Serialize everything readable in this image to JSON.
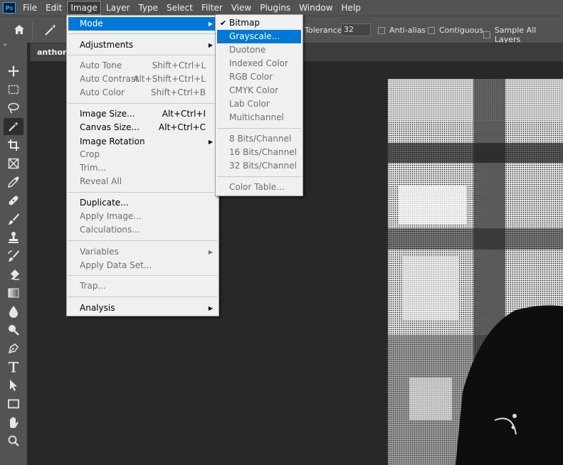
{
  "app": {
    "logo_text": "Ps"
  },
  "menubar": {
    "items": [
      "File",
      "Edit",
      "Image",
      "Layer",
      "Type",
      "Select",
      "Filter",
      "View",
      "Plugins",
      "Window",
      "Help"
    ]
  },
  "options": {
    "tolerance_label": "Tolerance:",
    "tolerance_value": "32",
    "antialias_label": "Anti-alias",
    "contiguous_label": "Contiguous",
    "sample_all_label": "Sample All Layers"
  },
  "toolbar": {
    "collapse": "»"
  },
  "tab": {
    "label": "anthony"
  },
  "image_menu": {
    "mode": "Mode",
    "adjustments": "Adjustments",
    "auto_tone": "Auto Tone",
    "auto_tone_sc": "Shift+Ctrl+L",
    "auto_contrast": "Auto Contrast",
    "auto_contrast_sc": "Alt+Shift+Ctrl+L",
    "auto_color": "Auto Color",
    "auto_color_sc": "Shift+Ctrl+B",
    "image_size": "Image Size...",
    "image_size_sc": "Alt+Ctrl+I",
    "canvas_size": "Canvas Size...",
    "canvas_size_sc": "Alt+Ctrl+C",
    "image_rotation": "Image Rotation",
    "crop": "Crop",
    "trim": "Trim...",
    "reveal_all": "Reveal All",
    "duplicate": "Duplicate...",
    "apply_image": "Apply Image...",
    "calculations": "Calculations...",
    "variables": "Variables",
    "apply_data_set": "Apply Data Set...",
    "trap": "Trap...",
    "analysis": "Analysis"
  },
  "mode_menu": {
    "bitmap": "Bitmap",
    "grayscale": "Grayscale...",
    "duotone": "Duotone",
    "indexed": "Indexed Color",
    "rgb": "RGB Color",
    "cmyk": "CMYK Color",
    "lab": "Lab Color",
    "multichannel": "Multichannel",
    "bits8": "8 Bits/Channel",
    "bits16": "16 Bits/Channel",
    "bits32": "32 Bits/Channel",
    "color_table": "Color Table..."
  },
  "colors": {
    "highlight": "#0078d7",
    "menubar": "#535353",
    "workspace": "#282828"
  }
}
